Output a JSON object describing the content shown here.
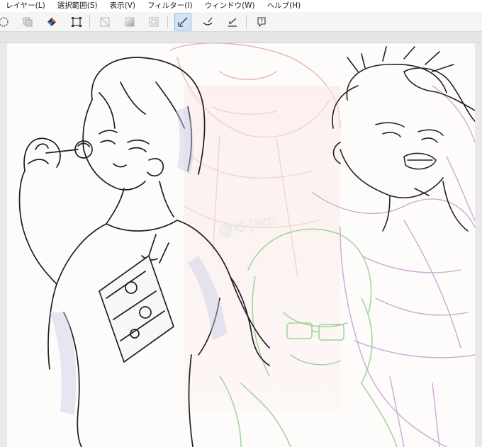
{
  "menu": {
    "items": [
      {
        "label": "レイヤー(L)"
      },
      {
        "label": "選択範囲(S)"
      },
      {
        "label": "表示(V)"
      },
      {
        "label": "フィルター(I)"
      },
      {
        "label": "ウィンドウ(W)"
      },
      {
        "label": "ヘルプ(H)"
      }
    ]
  },
  "toolbar": {
    "tools": [
      {
        "icon": "lasso-select-icon"
      },
      {
        "icon": "copy-layer-icon"
      },
      {
        "icon": "fill-bucket-icon"
      },
      {
        "icon": "transform-crop-icon"
      },
      {
        "icon": "clear-outside-icon"
      },
      {
        "icon": "gradient-fill-icon"
      },
      {
        "icon": "border-select-icon"
      },
      {
        "icon": "vector-pen-icon",
        "active": true
      },
      {
        "icon": "correct-line-icon"
      },
      {
        "icon": "ruler-line-icon"
      },
      {
        "icon": "help-icon"
      }
    ]
  },
  "canvas": {
    "watermark": "@ki-jam"
  },
  "colors": {
    "menubar_bg": "#ffffff",
    "toolbar_bg": "#f5f5f5",
    "active_tool": "#cfe5f7",
    "canvas_bg": "#fdfcfa",
    "lineart": "#1f1f1f",
    "sketch_pink": "#e9b8b8",
    "sketch_purple": "#cfa6d8",
    "sketch_green": "#9fd39a",
    "shading_blue": "#c7cbe6"
  }
}
